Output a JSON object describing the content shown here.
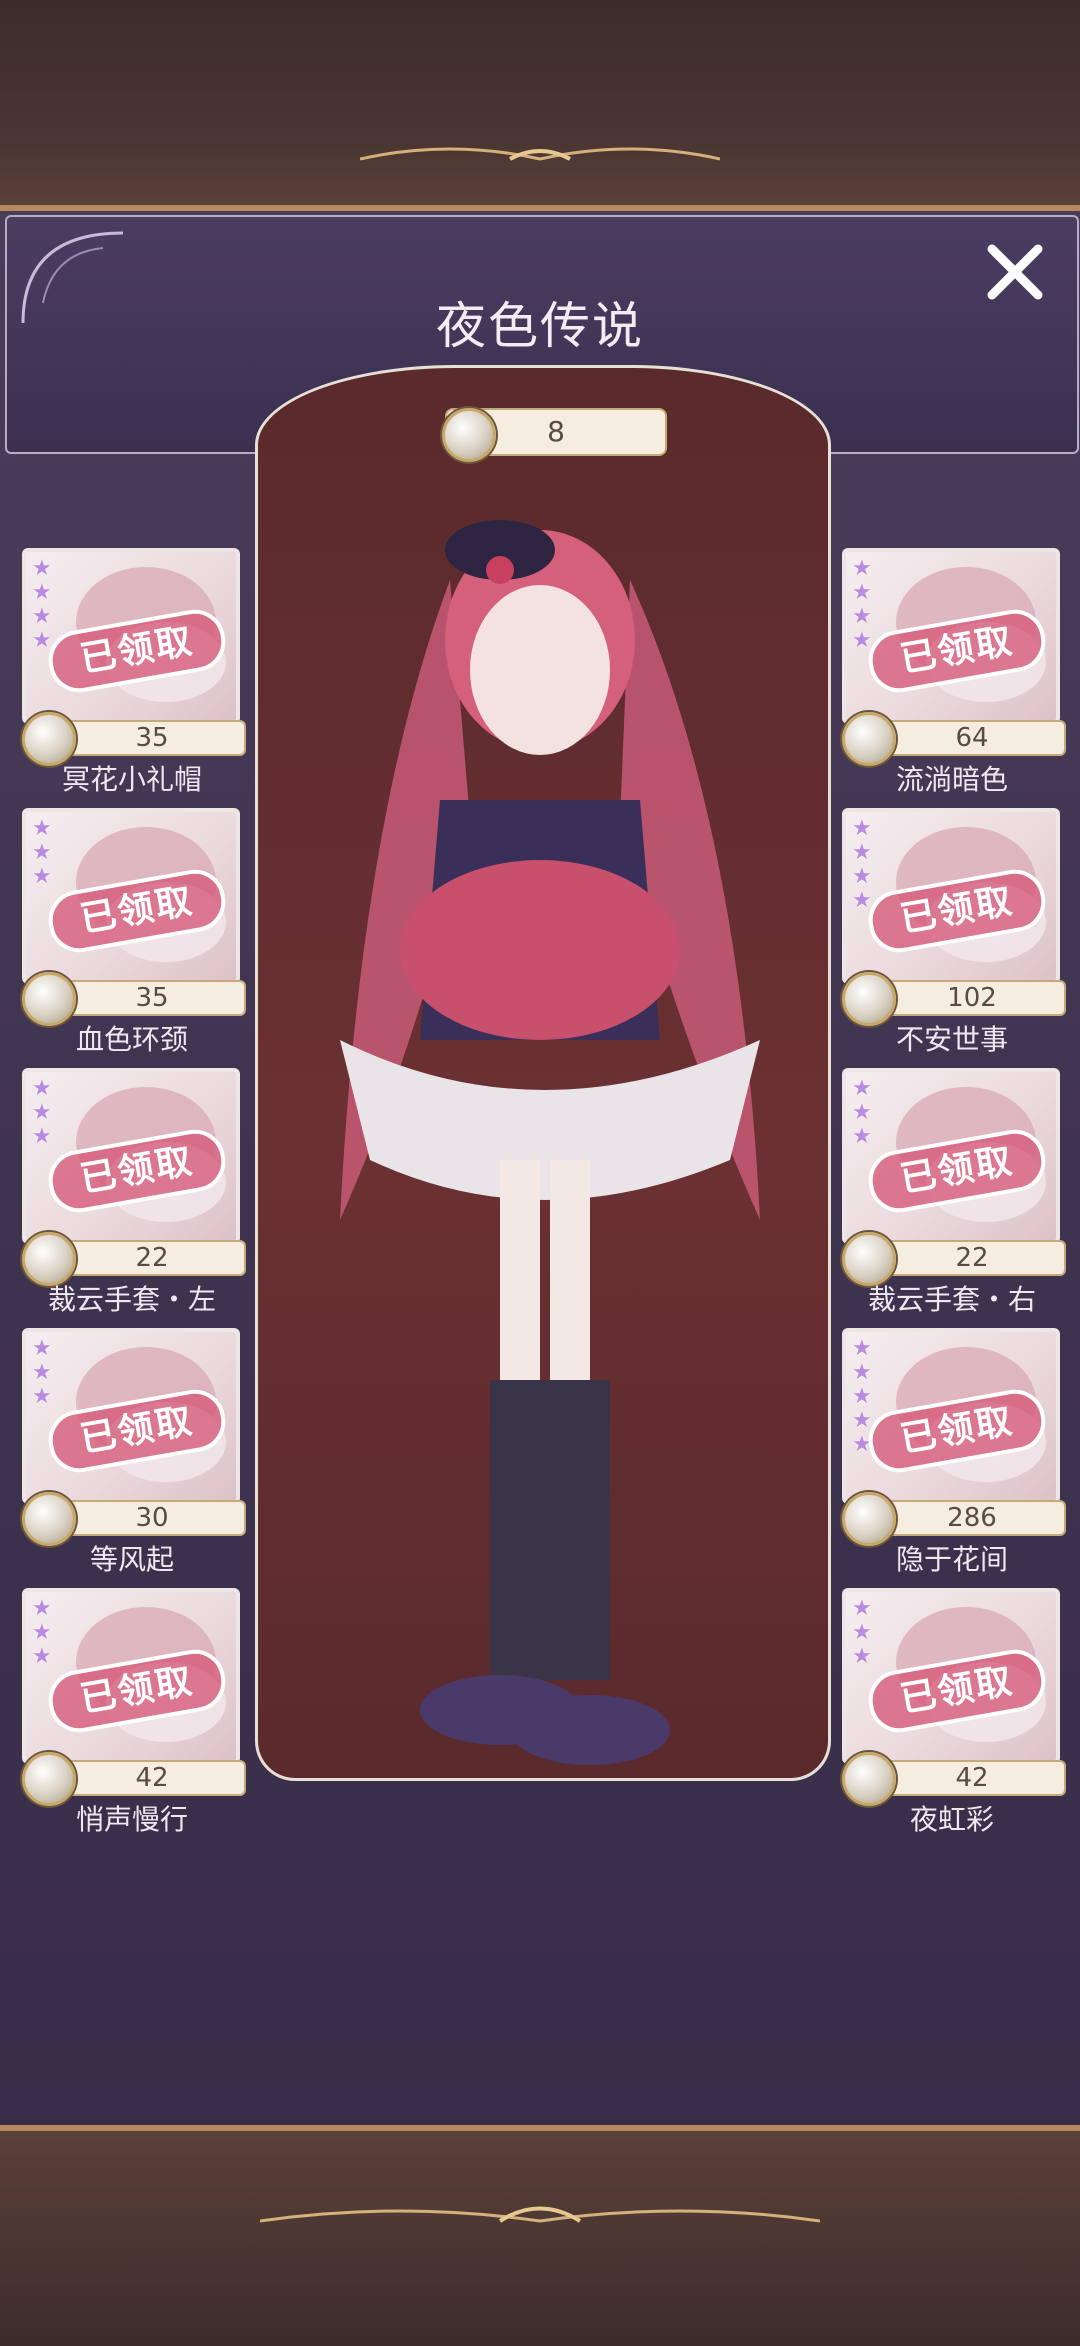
{
  "title": "夜色传说",
  "total_coins": "8",
  "stamp_text": "已领取",
  "colors": {
    "panel": "#3f3450",
    "stage": "#6b3032",
    "stamp": "#d65878",
    "star": "#b98be0"
  },
  "left_items": [
    {
      "name": "冥花小礼帽",
      "price": "35",
      "stars": 4
    },
    {
      "name": "血色环颈",
      "price": "35",
      "stars": 3
    },
    {
      "name": "裁云手套・左",
      "price": "22",
      "stars": 3
    },
    {
      "name": "等风起",
      "price": "30",
      "stars": 3
    },
    {
      "name": "悄声慢行",
      "price": "42",
      "stars": 3
    }
  ],
  "right_items": [
    {
      "name": "流淌暗色",
      "price": "64",
      "stars": 4
    },
    {
      "name": "不安世事",
      "price": "102",
      "stars": 4
    },
    {
      "name": "裁云手套・右",
      "price": "22",
      "stars": 3
    },
    {
      "name": "隐于花间",
      "price": "286",
      "stars": 5
    },
    {
      "name": "夜虹彩",
      "price": "42",
      "stars": 3
    }
  ],
  "icons": {
    "close": "close-icon",
    "coin": "coin-icon",
    "star": "star-icon"
  }
}
